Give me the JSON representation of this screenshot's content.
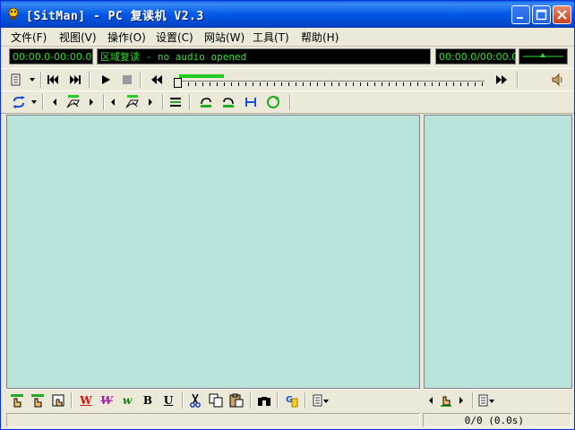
{
  "window": {
    "title": "[SitMan] - PC 复读机 V2.3"
  },
  "menu": [
    {
      "label": "文件(F)"
    },
    {
      "label": "视图(V)"
    },
    {
      "label": "操作(O)"
    },
    {
      "label": "设置(C)"
    },
    {
      "label": "网站(W)"
    },
    {
      "label": "工具(T)"
    },
    {
      "label": "帮助(H)"
    }
  ],
  "lcd": {
    "range": "00:00.0-00:00.0",
    "status": "区域复读 - no audio opened",
    "position": "00:00.0/00:00.0"
  },
  "editor_toolbar": {
    "bold": "B",
    "underline": "U",
    "w_red": "W",
    "w_purple": "W",
    "w_green": "w"
  },
  "statusbar": {
    "counter": "0/0 (0.0s)"
  },
  "colors": {
    "pane": "#b9e3dd",
    "lcd_text": "#2de22d",
    "lcd_bg": "#000000",
    "title_bar": "#0058e6"
  }
}
